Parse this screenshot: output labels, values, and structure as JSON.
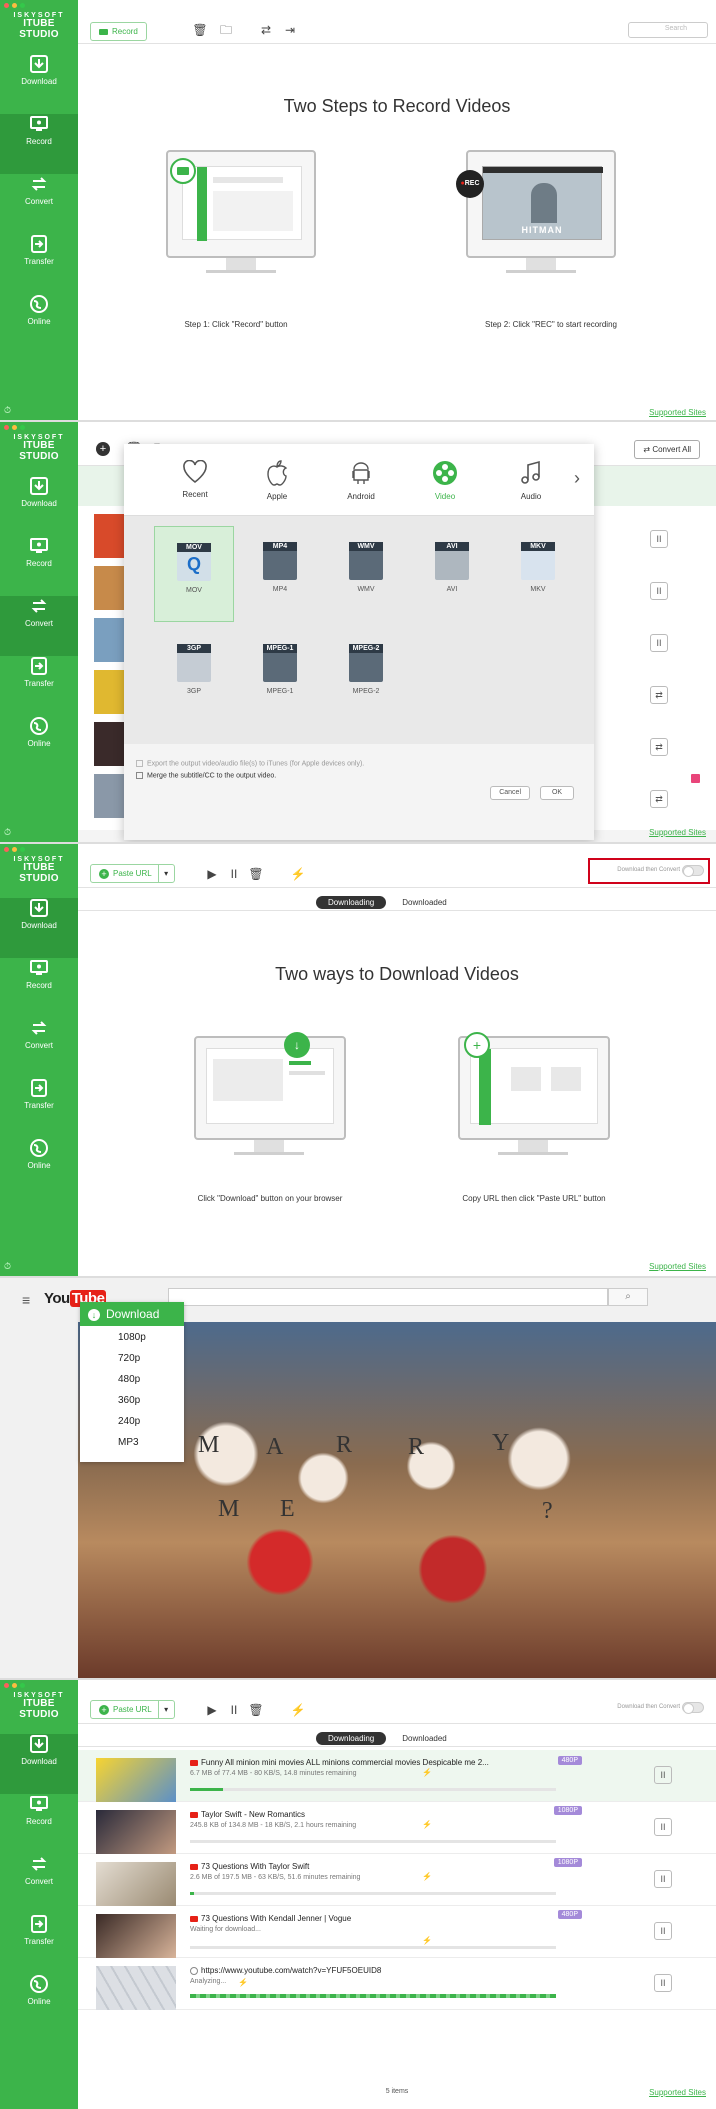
{
  "app": {
    "logo_line1": "ISKYSOFT",
    "logo_line2": "ITUBE STUDIO",
    "corner_glyph": "⏱"
  },
  "nav_labels": {
    "download": "Download",
    "record": "Record",
    "convert": "Convert",
    "transfer": "Transfer",
    "online": "Online"
  },
  "supported_sites": "Supported Sites",
  "record_screen": {
    "record_button": "Record",
    "search_placeholder": "Search",
    "title": "Two Steps to Record Videos",
    "step1": "Step 1: Click \"Record\" button",
    "step2": "Step 2: Click \"REC\" to start recording",
    "rec_badge": "REC",
    "hitman": "HITMAN"
  },
  "convert_screen": {
    "convert_all": "Convert All",
    "tabs": [
      "Recent",
      "Apple",
      "Android",
      "Video",
      "Audio"
    ],
    "formats_row1": [
      {
        "icon": "MOV",
        "label": "MOV"
      },
      {
        "icon": "MP4",
        "label": "MP4"
      },
      {
        "icon": "WMV",
        "label": "WMV"
      },
      {
        "icon": "AVI",
        "label": "AVI"
      },
      {
        "icon": "MKV",
        "label": "MKV"
      }
    ],
    "formats_row2": [
      {
        "icon": "3GP",
        "label": "3GP"
      },
      {
        "icon": "MPEG-1",
        "label": "MPEG-1"
      },
      {
        "icon": "MPEG-2",
        "label": "MPEG-2"
      }
    ],
    "export_itunes": "Export the output video/audio file(s) to iTunes (for Apple devices only).",
    "merge_subtitle": "Merge the subtitle/CC to the output video.",
    "cancel": "Cancel",
    "ok": "OK"
  },
  "download_screen": {
    "paste_url": "Paste URL",
    "download_then_convert": "Download then Convert",
    "tab_downloading": "Downloading",
    "tab_downloaded": "Downloaded",
    "title": "Two ways to Download Videos",
    "caption1": "Click \"Download\" button on your browser",
    "caption2": "Copy URL then click \"Paste URL\" button"
  },
  "youtube": {
    "logo_you": "You",
    "logo_tube": "Tube",
    "download_button": "Download",
    "resolutions": [
      "1080p",
      "720p",
      "480p",
      "360p",
      "240p",
      "MP3"
    ],
    "sign_letters": [
      "M",
      "A",
      "R",
      "R",
      "Y",
      "M",
      "E",
      "?"
    ]
  },
  "list_screen": {
    "paste_url": "Paste URL",
    "download_then_convert": "Download then Convert",
    "tab_downloading": "Downloading",
    "tab_downloaded": "Downloaded",
    "items": [
      {
        "title": "Funny All minion mini movies ALL minions commercial movies Despicable me 2...",
        "status": "6.7 MB of 77.4 MB - 80 KB/S, 14.8 minutes remaining",
        "quality": "480P",
        "progress": 0.09
      },
      {
        "title": "Taylor Swift - New Romantics",
        "status": "245.8 KB of 134.8 MB - 18 KB/S, 2.1 hours remaining",
        "quality": "1080P",
        "progress": 0.0
      },
      {
        "title": "73 Questions With Taylor Swift",
        "status": "2.6 MB of 197.5 MB - 63 KB/S, 51.6 minutes remaining",
        "quality": "1080P",
        "progress": 0.01
      },
      {
        "title": "73 Questions With Kendall Jenner | Vogue",
        "status": "Waiting for download...",
        "quality": "480P",
        "progress": 0.0
      },
      {
        "title": "https://www.youtube.com/watch?v=YFUF5OEUID8",
        "status": "Analyzing...",
        "quality": "",
        "progress": 1.0
      }
    ],
    "count": "5 items"
  },
  "colors": {
    "green": "#3cb44a",
    "green_dark": "#2f9a3c",
    "purple_badge": "#a48ad9",
    "red_highlight": "#d0021b"
  }
}
